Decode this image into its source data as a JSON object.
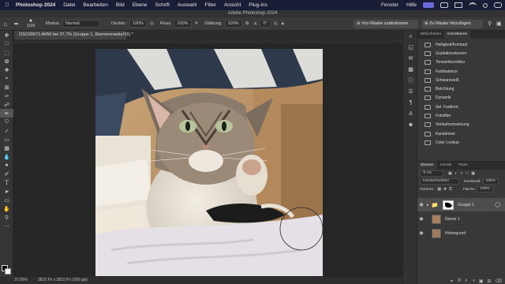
{
  "menubar": {
    "app": "Photoshop 2024",
    "items": [
      "Datei",
      "Bearbeiten",
      "Bild",
      "Ebene",
      "Schrift",
      "Auswahl",
      "Filter",
      "Ansicht",
      "Plug-ins"
    ],
    "right_items": [
      "Fenster",
      "Hilfe"
    ]
  },
  "window": {
    "title": "Adobe Photoshop 2024"
  },
  "options": {
    "brush_size": "1100",
    "modus_label": "Modus:",
    "modus_value": "Normal",
    "deckkraft_label": "Deckkr.:",
    "deckkraft_value": "100%",
    "fluss_label": "Fluss:",
    "fluss_value": "100%",
    "glaettung_label": "Glättung:",
    "glaettung_value": "100%",
    "angle_value": "0°",
    "subtract_button": "Von Maske subtrahieren",
    "add_button": "Zu Maske hinzufügen"
  },
  "document": {
    "tab_label": "DSC00672.ARW bei 37,7% (Gruppe 1, Ebenenmaske/16) *"
  },
  "status": {
    "zoom": "37,69%",
    "info": "3815 Px x 3815 Px (300 ppi)"
  },
  "panels": {
    "top_tabs": [
      "Bibliotheken",
      "Korrekturen"
    ],
    "adjustments": [
      "Helligkeit/Kontrast",
      "Gradationskurven",
      "Tonwertkorrektur",
      "Farbbalance",
      "Schwarzweiß",
      "Belichtung",
      "Dynamik",
      "Sel. Farbkorr.",
      "Fotofilter",
      "Verlaufsumsetzung",
      "Kanalmixer",
      "Color Lookup"
    ],
    "layer_tabs": [
      "Ebenen",
      "Kanäle",
      "Pfade"
    ],
    "layer_filter": "Art",
    "blend_mode": "Hindurchwirken",
    "opacity_label": "Deckkraft:",
    "opacity_value": "100%",
    "fixieren_label": "Fixieren:",
    "flaeche_label": "Fläche:",
    "flaeche_value": "100%",
    "layers": [
      {
        "name": "Gruppe 1",
        "selected": true
      },
      {
        "name": "Ebene 1",
        "selected": false
      },
      {
        "name": "Hintergrund",
        "selected": false
      }
    ]
  },
  "colors": {
    "menubar_bg": "#1a1d36",
    "panel_bg": "#383838",
    "canvas_bg": "#262626"
  }
}
